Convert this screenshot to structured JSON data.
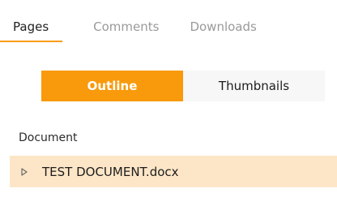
{
  "tabs": [
    {
      "label": "Pages",
      "active": true
    },
    {
      "label": "Comments",
      "active": false
    },
    {
      "label": "Downloads",
      "active": false
    }
  ],
  "view_toggle": {
    "outline_label": "Outline",
    "thumbnails_label": "Thumbnails",
    "selected": "Outline"
  },
  "section": {
    "label": "Document"
  },
  "tree": {
    "items": [
      {
        "label": "TEST DOCUMENT.docx",
        "icon": "caret-right-icon",
        "expanded": false,
        "selected": true
      }
    ]
  },
  "colors": {
    "accent": "#f89a0c",
    "selected_row": "#fde6c7",
    "inactive_tab_text": "#9a9a9a"
  }
}
